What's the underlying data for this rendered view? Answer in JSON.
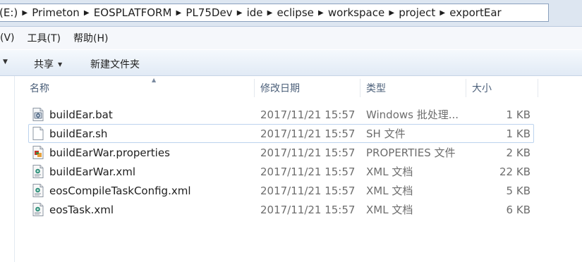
{
  "address": {
    "prefix": "(E:)",
    "crumbs": [
      "Primeton",
      "EOSPLATFORM",
      "PL75Dev",
      "ide",
      "eclipse",
      "workspace",
      "project",
      "exportEar"
    ]
  },
  "menu": {
    "items": [
      "(V)",
      "工具(T)",
      "帮助(H)"
    ]
  },
  "toolbar": {
    "share_label": "共享",
    "new_folder_label": "新建文件夹"
  },
  "columns": {
    "name": "名称",
    "modified": "修改日期",
    "type": "类型",
    "size": "大小"
  },
  "files": [
    {
      "name": "buildEar.bat",
      "modified": "2017/11/21 15:57",
      "type": "Windows 批处理...",
      "size": "1 KB",
      "icon": "batch-file-icon"
    },
    {
      "name": "buildEar.sh",
      "modified": "2017/11/21 15:57",
      "type": "SH 文件",
      "size": "1 KB",
      "icon": "blank-file-icon"
    },
    {
      "name": "buildEarWar.properties",
      "modified": "2017/11/21 15:57",
      "type": "PROPERTIES 文件",
      "size": "2 KB",
      "icon": "properties-file-icon"
    },
    {
      "name": "buildEarWar.xml",
      "modified": "2017/11/21 15:57",
      "type": "XML 文档",
      "size": "22 KB",
      "icon": "xml-file-icon"
    },
    {
      "name": "eosCompileTaskConfig.xml",
      "modified": "2017/11/21 15:57",
      "type": "XML 文档",
      "size": "5 KB",
      "icon": "xml-file-icon"
    },
    {
      "name": "eosTask.xml",
      "modified": "2017/11/21 15:57",
      "type": "XML 文档",
      "size": "6 KB",
      "icon": "xml-file-icon"
    }
  ],
  "colors": {
    "address_bg": "#dde6f1",
    "toolbar_bg": "#e1eaf5",
    "header_text": "#4c607a",
    "secondary_text": "#6d6d6d",
    "selection_border": "#bcd3ee"
  }
}
